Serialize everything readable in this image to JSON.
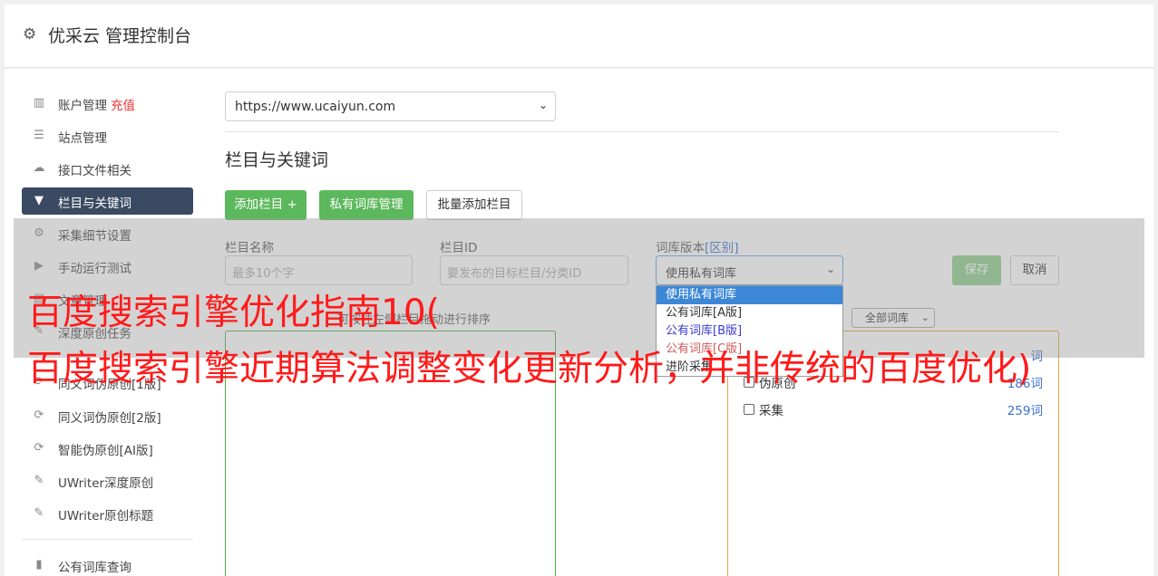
{
  "app": {
    "title": "优采云 管理控制台"
  },
  "sidebar": {
    "items": [
      {
        "label": "账户管理",
        "extra": "充值",
        "icon": "bar-chart-icon"
      },
      {
        "label": "站点管理",
        "icon": "server-icon"
      },
      {
        "label": "接口文件相关",
        "icon": "cloud-upload-icon"
      },
      {
        "label": "栏目与关键词",
        "icon": "filter-icon",
        "active": true
      },
      {
        "label": "采集细节设置",
        "icon": "cogs-icon"
      },
      {
        "label": "手动运行测试",
        "icon": "play-icon"
      },
      {
        "label": "文章管理",
        "icon": "file-icon"
      },
      {
        "label": "深度原创任务",
        "icon": "edit-icon"
      },
      {
        "label": "同义词伪原创[1版]",
        "icon": "refresh-icon"
      },
      {
        "label": "同义词伪原创[2版]",
        "icon": "refresh-icon"
      },
      {
        "label": "智能伪原创[AI版]",
        "icon": "refresh-icon"
      },
      {
        "label": "UWriter深度原创",
        "icon": "edit-icon"
      },
      {
        "label": "UWriter原创标题",
        "icon": "edit-icon"
      },
      {
        "label": "公有词库查询",
        "icon": "book-icon"
      }
    ]
  },
  "main": {
    "site_select": "https://www.ucaiyun.com",
    "section_title": "栏目与关键词",
    "buttons": {
      "add_column": "添加栏目 +",
      "private_lib": "私有词库管理",
      "batch_add": "批量添加栏目"
    },
    "form": {
      "name_label": "栏目名称",
      "name_placeholder": "最多10个字",
      "id_label": "栏目ID",
      "id_placeholder": "要发布的目标栏目/分类ID",
      "version_label": "词库版本",
      "version_diff": "[区别]",
      "version_value": "使用私有词库",
      "save": "保存",
      "cancel": "取消"
    },
    "dropdown_options": [
      {
        "label": "使用私有词库",
        "style": "highlighted"
      },
      {
        "label": "公有词库[A版]",
        "style": "normal"
      },
      {
        "label": "公有词库[B版]",
        "style": "blue"
      },
      {
        "label": "公有词库[C版]",
        "style": "red"
      },
      {
        "label": "进阶采集",
        "style": "normal"
      }
    ],
    "hint": "可按住左侧栏目拖动进行排序",
    "lib_filter": "全部词库",
    "library_rows": [
      {
        "name": "",
        "count": "词"
      },
      {
        "name": "伪原创",
        "count": "186词"
      },
      {
        "name": "采集",
        "count": "259词"
      }
    ]
  },
  "overlay": {
    "headline_line1": "百度搜索引擎优化指南10(",
    "headline_line2": "百度搜索引擎近期算法调整变化更新分析，并非传统的百度优化)"
  }
}
